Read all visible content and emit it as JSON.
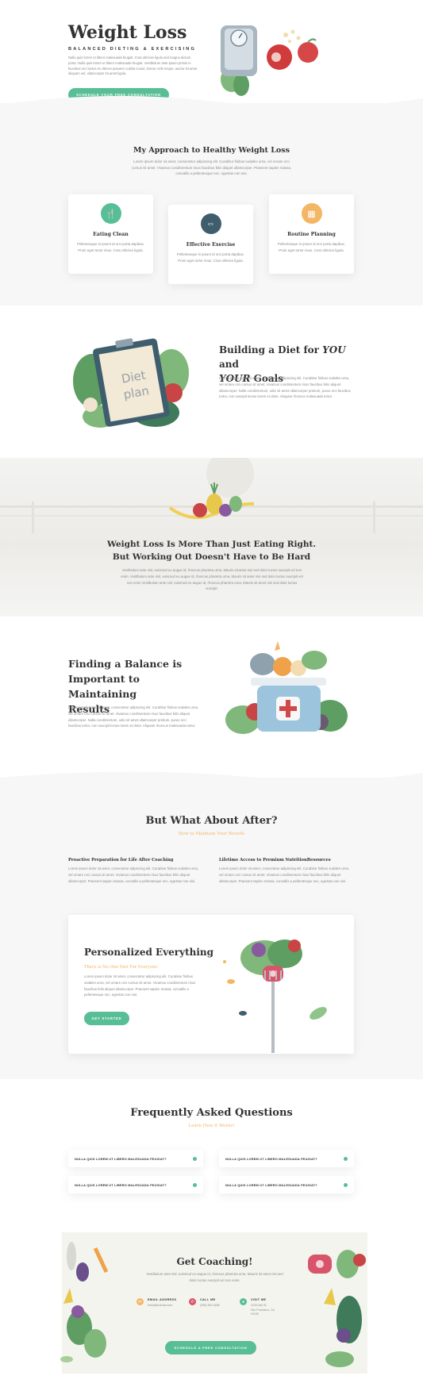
{
  "hero": {
    "title": "Weight Loss",
    "subtitle": "BALANCED DIETING & EXERCISING",
    "body": "Nulla quis lorem ut libero malesuada feugiat. Cras ultricies ligula sed magna dictum porta. Nulla quis lorem ut libero malesuada feugiat. Vestibulum ante ipsum primis in faucibus orci luctus et ultrices posuere cubilia Curae; Donec velit neque, auctor sit amet aliquam vel, ullamcorper sit amet ligula.",
    "cta": "SCHEDULE YOUR FREE CONSULTATION"
  },
  "approach": {
    "title": "My Approach to Healthy Weight Loss",
    "body": "Lorem ipsum dolor sit amet, consectetur adipiscing elit. Curabitur finibus sodales urna, vel ornare orci cursus sit amet. Vivamus condimentum risus faucibus felis aliquet ullamcorper. Praesent sapien massa, convallis a pellentesque nec, egestas non nisi.",
    "features": [
      {
        "icon": "utensils-icon",
        "glyph": "🍴",
        "color": "#57be96",
        "title": "Eating Clean",
        "body": "Pellentesque in ipsum id orci porta dapibus. Proin eget tortor risus. Cras ultricies ligula."
      },
      {
        "icon": "dumbbell-icon",
        "glyph": "⇔",
        "color": "#3f5e6d",
        "title": "Effective Exercise",
        "body": "Pellentesque in ipsum id orci porta dapibus. Proin eget tortor risus. Cras ultricies ligula."
      },
      {
        "icon": "calendar-icon",
        "glyph": "▦",
        "color": "#f3b664",
        "title": "Routine Planning",
        "body": "Pellentesque in ipsum id orci porta dapibus. Proin eget tortor risus. Cras ultricies ligula."
      }
    ]
  },
  "diet": {
    "title_a": "Building a Diet for ",
    "title_em1": "YOU",
    "title_b": " and",
    "title_em2": "YOUR",
    "title_c": " Goals",
    "clipboard_line1": "Diet",
    "clipboard_line2": "plan",
    "body": "Lorem ipsum dolor sit amet, consectetur adipiscing elit. Curabitur finibus sodales urna, vel ornare orci cursus sit amet. Vivamus condimentum risus faucibus felis aliquet ullamcorper. Nulla condimentum, odio sit amet ullamcorper pretium, purus orci faucibus tortor, non suscipit lectus lorem et dolor. Aliquam rhoncus malesuada tortor."
  },
  "outdoor": {
    "title_line1": "Weight Loss Is More Than Just Eating Right.",
    "title_line2": "But Working Out Doesn't Have to Be Hard",
    "body": "Vestibulum ante nisl, euismod eu augue id, rhoncus pharetra urna. Mauris sit amet nisi sed dolor luctus suscipit vel non enim. Vestibulum ante nisl, euismod eu augue id, rhoncus pharetra urna. Mauris sit amet nisi sed dolor luctus suscipit vel non enim Vestibulum ante nisl, euismod eu augue id, rhoncus pharetra urna. Mauris sit amet nisi sed dolor luctus suscipit."
  },
  "balance": {
    "title_line1": "Finding a Balance is",
    "title_line2": "Important to Maintaining",
    "title_line3": "Results",
    "body": "Lorem ipsum dolor sit amet, consectetur adipiscing elit. Curabitur finibus sodales urna, vel ornare orci cursus sit amet. Vivamus condimentum risus faucibus felis aliquet ullamcorper. Nulla condimentum, odio sit amet ullamcorper pretium, purus orci faucibus tortor, non suscipit lectus lorem et dolor. Aliquam rhoncus malesuada tortor."
  },
  "after": {
    "title": "But What About After?",
    "subtitle": "How to Maintain Your Results",
    "col1_title": "Proactive Preparation for Life After Coaching",
    "col1_body": "Lorem ipsum dolor sit amet, consectetur adipiscing elit. Curabitur finibus sodales urna, vel ornare orci cursus sit amet. Vivamus condimentum risus faucibus felis aliquet ullamcorper. Praesent sapien massa, convallis a pellentesque nec, egestas non nisi.",
    "col2_title": "Lifetime Access to Premium NutritionResources",
    "col2_body": "Lorem ipsum dolor sit amet, consectetur adipiscing elit. Curabitur finibus sodales urna, vel ornare orci cursus sit amet. Vivamus condimentum risus faucibus felis aliquet ullamcorper. Praesent sapien massa, convallis a pellentesque nec, egestas non nisi."
  },
  "personal": {
    "title": "Personalized Everything",
    "subtitle": "There is No One Diet For Everyone",
    "body": "Lorem ipsum dolor sit amet, consectetur adipiscing elit. Curabitur finibus sodales urna, vel ornare orci cursus sit amet. Vivamus condimentum risus faucibus felis aliquet ullamcorper. Praesent sapien massa, convallis a pellentesque nec, egestas non nisi.",
    "cta": "GET STARTED"
  },
  "faq": {
    "title": "Frequently Asked Questions",
    "subtitle": "Learn How it Works!",
    "items": [
      "NULLA QUIS LOREM UT LIBERO MALESUADA FEUGIAT?",
      "NULLA QUIS LOREM UT LIBERO MALESUADA FEUGIAT?",
      "NULLA QUIS LOREM UT LIBERO MALESUADA FEUGIAT?",
      "NULLA QUIS LOREM UT LIBERO MALESUADA FEUGIAT?"
    ]
  },
  "coaching": {
    "title": "Get Coaching!",
    "body": "Vestibulum ante nisl, euismod eu augue id, rhoncus pharetra urna. Mauris sit amet nisi sed dolor luctus suscipit vel non enim.",
    "email_label": "EMAIL ADDRESS",
    "email_value": "hello@divinutri.com",
    "call_label": "CALL ME",
    "call_value": "(255) 352-6258",
    "visit_label": "VISIT ME",
    "visit_line1": "1234 Divi St.",
    "visit_line2": "San Francisco, CA",
    "visit_line3": "91155",
    "cta": "SCHEDULE A FREE CONSULTATION"
  },
  "colors": {
    "accent_green": "#57be96",
    "accent_orange": "#f3b664",
    "dark_slate": "#3f5e6d"
  }
}
